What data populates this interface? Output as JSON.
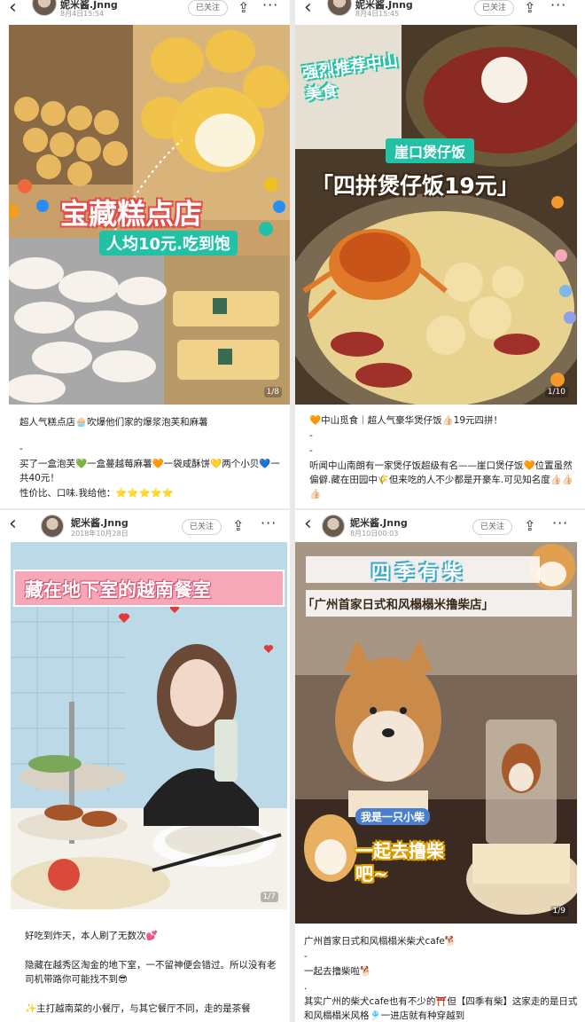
{
  "posts": [
    {
      "user": "妮米酱.Jnng",
      "date": "8月4日15:54",
      "follow": "已关注",
      "overlay_title": "宝藏糕点店",
      "overlay_sub": "人均10元.吃到饱",
      "page": "1/8",
      "caption": [
        "超人气糕点店🧁吹爆他们家的爆浆泡芙和麻薯",
        "-",
        "买了一盒泡芙💚一盒蔓越莓麻薯🧡一袋咸酥饼💛两个小贝💙一共40元！",
        "性价比、口味.我给他：⭐⭐⭐⭐⭐"
      ]
    },
    {
      "user": "妮米酱.Jnng",
      "date": "8月4日15:45",
      "follow": "已关注",
      "overlay_top": "强烈推荐中山美食",
      "overlay_tag": "崖口煲仔饭",
      "overlay_title": "「四拼煲仔饭19元」",
      "page": "1/10",
      "caption": [
        "🧡中山觅食｜超人气豪华煲仔饭👍🏻19元四拼！",
        "-",
        "-",
        "听闻中山南朗有一家煲仔饭超级有名——崖口煲仔饭🧡位置虽然偏僻.藏在田园中🌾但来吃的人不少都是开豪车.可见知名度👍🏻👍🏻👍🏻"
      ]
    },
    {
      "user": "妮米酱.Jnng",
      "date": "2018年10月28日",
      "follow": "已关注",
      "overlay_title": "藏在地下室的越南餐室",
      "page": "1/7",
      "caption": [
        "好吃到炸天，本人刷了无数次💕",
        "",
        "隐藏在越秀区淘金的地下室，一不留神便会错过。所以没有老司机带路你可能找不到😎",
        "",
        "✨主打越南菜的小餐厅，与其它餐厅不同，走的是茶餐"
      ]
    },
    {
      "user": "妮米酱.Jnng",
      "date": "8月10日00:03",
      "follow": "已关注",
      "overlay_title": "四季有柴",
      "overlay_sub": "「广州首家日式和风榻榻米撸柴店」",
      "overlay_bubble": "我是一只小柴",
      "overlay_go": "一起去撸柴吧~",
      "page": "1/9",
      "caption": [
        "广州首家日式和风榻榻米柴犬cafe🐕",
        "-",
        "一起去撸柴啦🐕",
        ".",
        "其实广州的柴犬cafe也有不少的⛩️但【四季有柴】这家走的是日式和风榻榻米风格🎐一进店就有种穿越到"
      ]
    }
  ],
  "icons": {
    "back": "chevron-left-icon",
    "share": "share-icon",
    "more": "more-icon"
  },
  "colors": {
    "accent_red": "#e24c4c",
    "pink": "#f6a8b8",
    "teal": "#22c1a5"
  }
}
